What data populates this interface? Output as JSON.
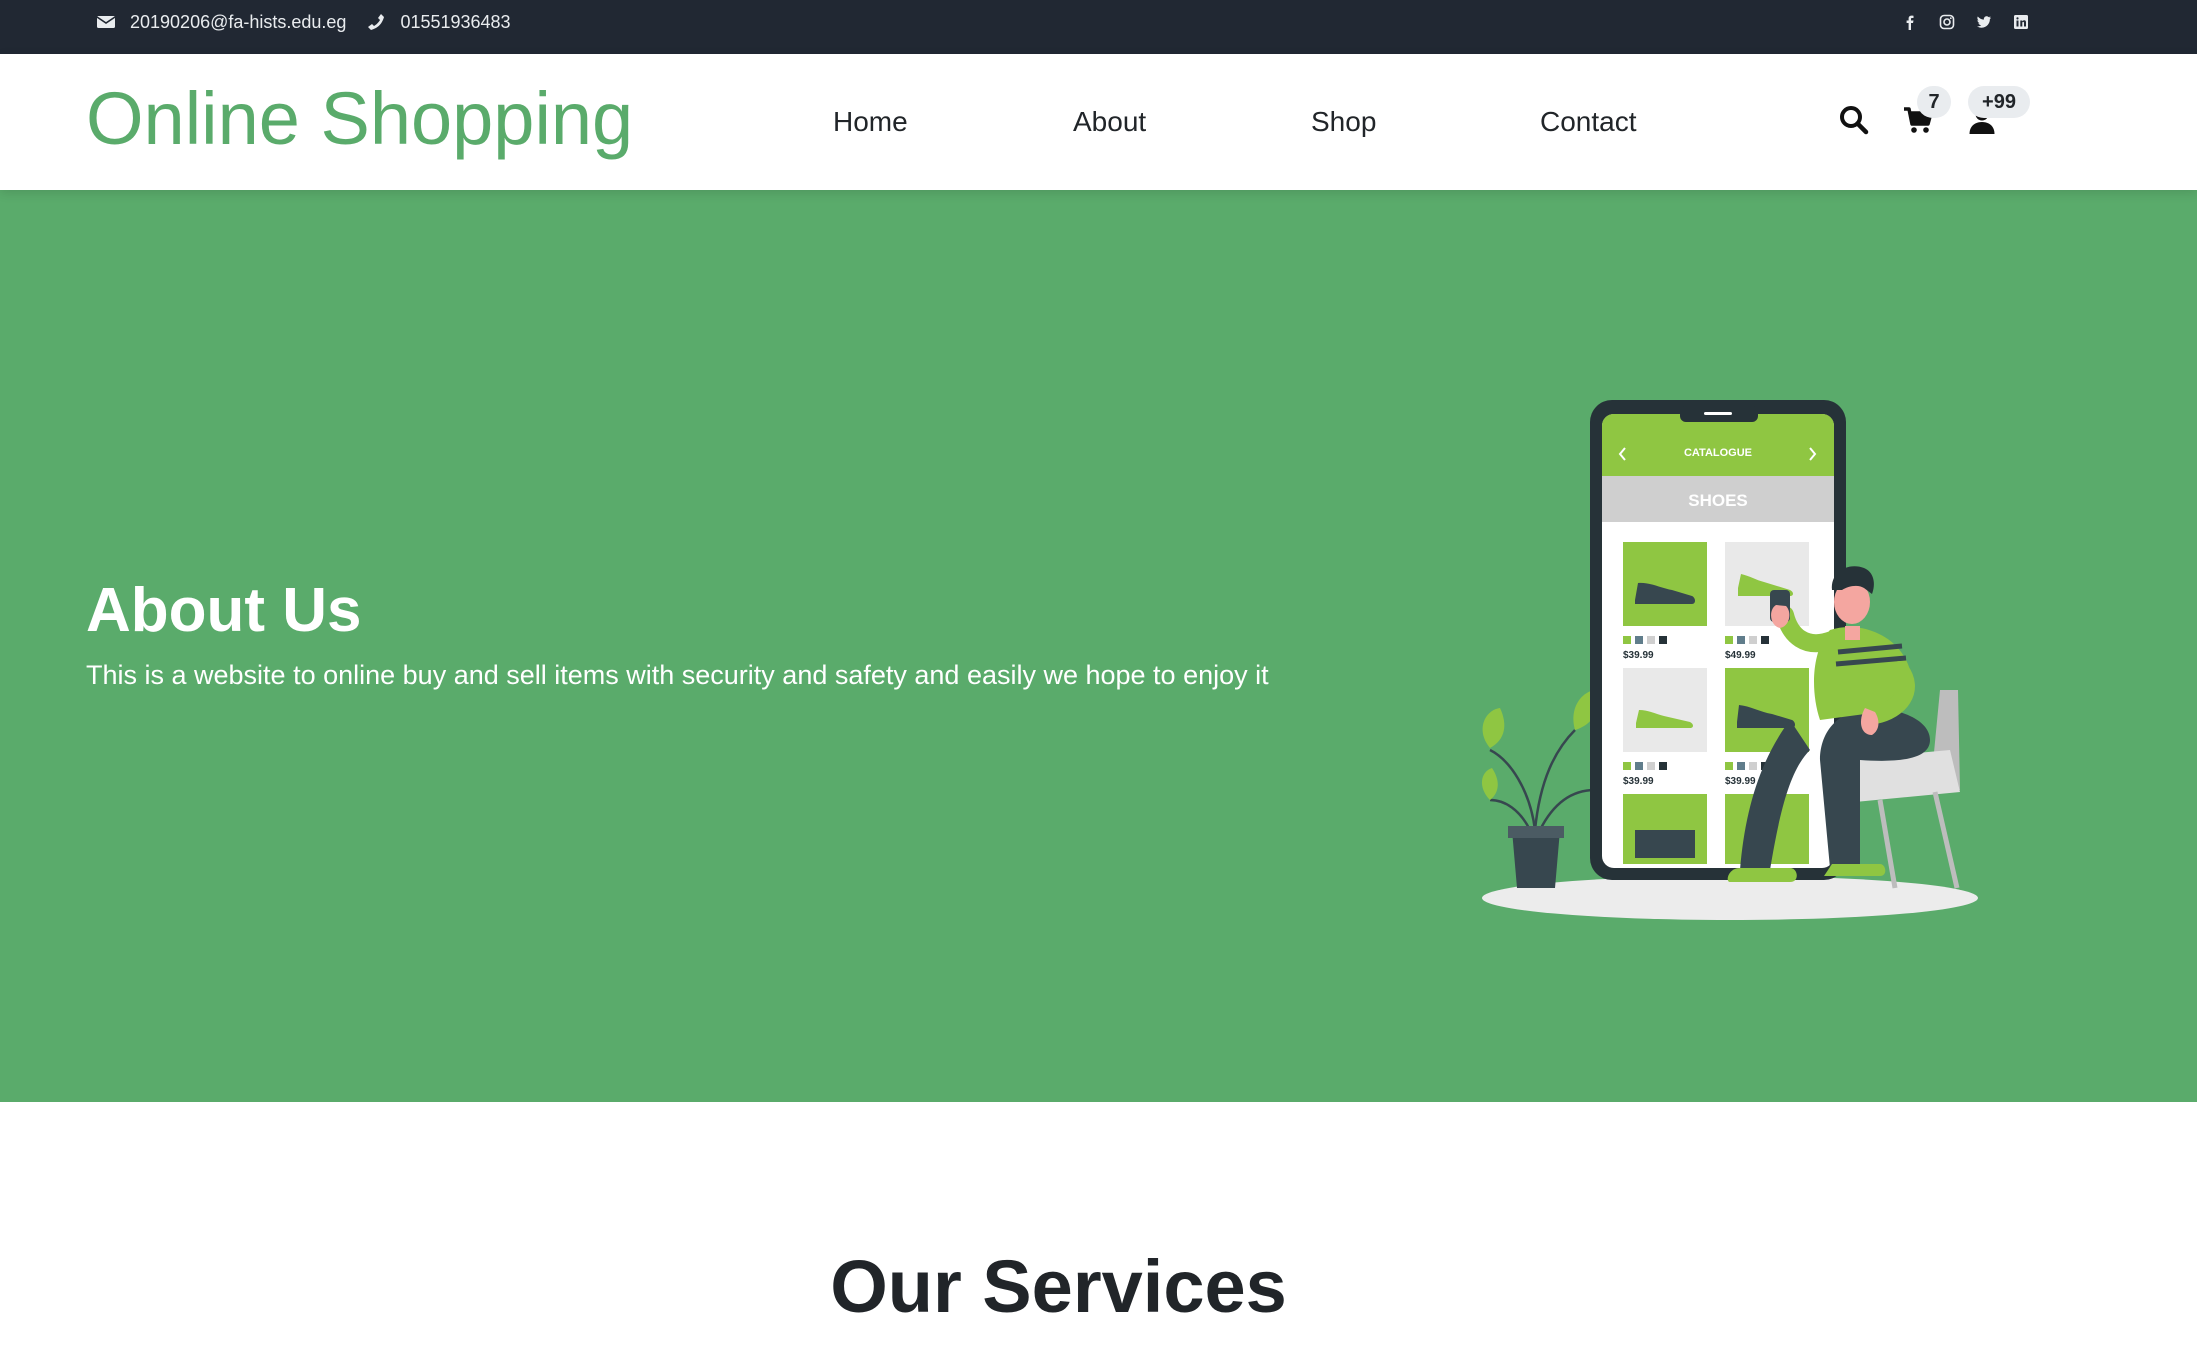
{
  "topbar": {
    "email": "20190206@fa-hists.edu.eg",
    "phone": "01551936483",
    "social": [
      "facebook-icon",
      "instagram-icon",
      "twitter-icon",
      "linkedin-icon"
    ]
  },
  "navbar": {
    "brand": "Online Shopping",
    "links": [
      "Home",
      "About",
      "Shop",
      "Contact"
    ],
    "cart_count": "7",
    "user_count": "+99",
    "icons": [
      "search-icon",
      "cart-icon",
      "user-icon"
    ]
  },
  "hero": {
    "title": "About Us",
    "text": "This is a website to online buy and sell items with security and safety and easily we hope to enjoy it",
    "illustration": {
      "screen_header": "CATALOGUE",
      "category": "SHOES",
      "prices": [
        "$39.99",
        "$49.99",
        "$39.99",
        "$39.99"
      ]
    }
  },
  "services": {
    "title": "Our Services"
  },
  "colors": {
    "brand_green": "#5aab6b",
    "topbar_bg": "#212833",
    "illustration_green": "#8fc642",
    "dark": "#37474f"
  }
}
